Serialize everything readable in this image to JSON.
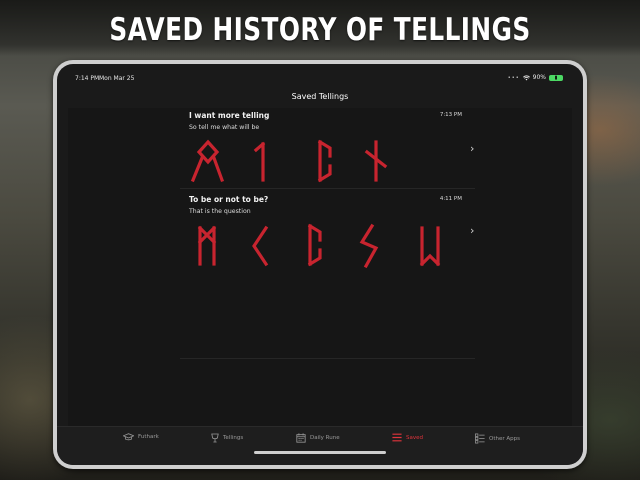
{
  "headline": "SAVED HISTORY OF TELLINGS",
  "status": {
    "time": "7:14 PM",
    "date": "Mon Mar 25",
    "battery": "90%"
  },
  "nav": {
    "title": "Saved Tellings"
  },
  "tellings": [
    {
      "title": "I want more telling",
      "time": "7:13 PM",
      "subtitle": "So tell me what will be",
      "runes": [
        "Othala",
        "Isa",
        "Perthro",
        "Nauthiz"
      ]
    },
    {
      "title": "To be or not to be?",
      "time": "4:11 PM",
      "subtitle": "That is the question",
      "runes": [
        "Mannaz",
        "Kenaz",
        "Perthro",
        "Sowilo",
        "Wunjo-reversed"
      ]
    }
  ],
  "tabs": [
    {
      "label": "Futhark",
      "icon": "graduation-cap-icon"
    },
    {
      "label": "Tellings",
      "icon": "cup-icon"
    },
    {
      "label": "Daily Rune",
      "icon": "calendar-icon"
    },
    {
      "label": "Saved",
      "icon": "list-icon",
      "active": true
    },
    {
      "label": "Other Apps",
      "icon": "apps-list-icon"
    }
  ],
  "colors": {
    "accent": "#e0333b",
    "rune": "#c8242f",
    "background": "#1a1a1a"
  }
}
